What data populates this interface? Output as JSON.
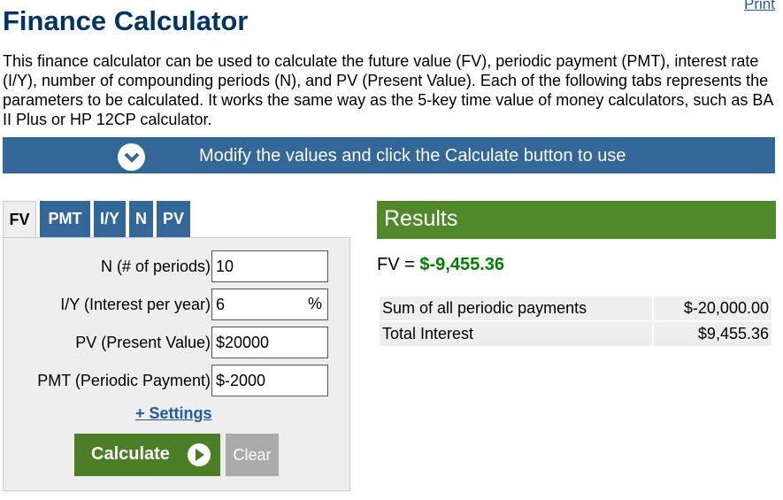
{
  "header": {
    "print_label": "Print",
    "title": "Finance Calculator",
    "intro": "This finance calculator can be used to calculate the future value (FV), periodic payment (PMT), interest rate (I/Y), number of compounding periods (N), and PV (Present Value). Each of the following tabs represents the parameters to be calculated. It works the same way as the 5-key time value of money calculators, such as BA II Plus or HP 12CP calculator."
  },
  "banner": {
    "icon": "chevron-down-icon",
    "text": "Modify the values and click the Calculate button to use"
  },
  "tabs": [
    "FV",
    "PMT",
    "I/Y",
    "N",
    "PV"
  ],
  "active_tab": "FV",
  "form": {
    "n_label": "N (# of periods)",
    "n_value": "10",
    "iy_label": "I/Y (Interest per year)",
    "iy_value": "6",
    "iy_suffix": "%",
    "pv_label": "PV (Present Value)",
    "pv_value": "$20000",
    "pmt_label": "PMT (Periodic Payment)",
    "pmt_value": "$-2000",
    "settings_label": "+ Settings",
    "calculate_label": "Calculate",
    "clear_label": "Clear"
  },
  "results": {
    "header": "Results",
    "fv_label": "FV = ",
    "fv_value": "$-9,455.36",
    "rows": [
      {
        "label": "Sum of all periodic payments",
        "value": "$-20,000.00"
      },
      {
        "label": "Total Interest",
        "value": "$9,455.36"
      }
    ]
  },
  "colors": {
    "title": "#003366",
    "banner": "#336699",
    "results_header": "#51892a",
    "calculate_button": "#4b7e26",
    "fv_value": "#008000"
  }
}
